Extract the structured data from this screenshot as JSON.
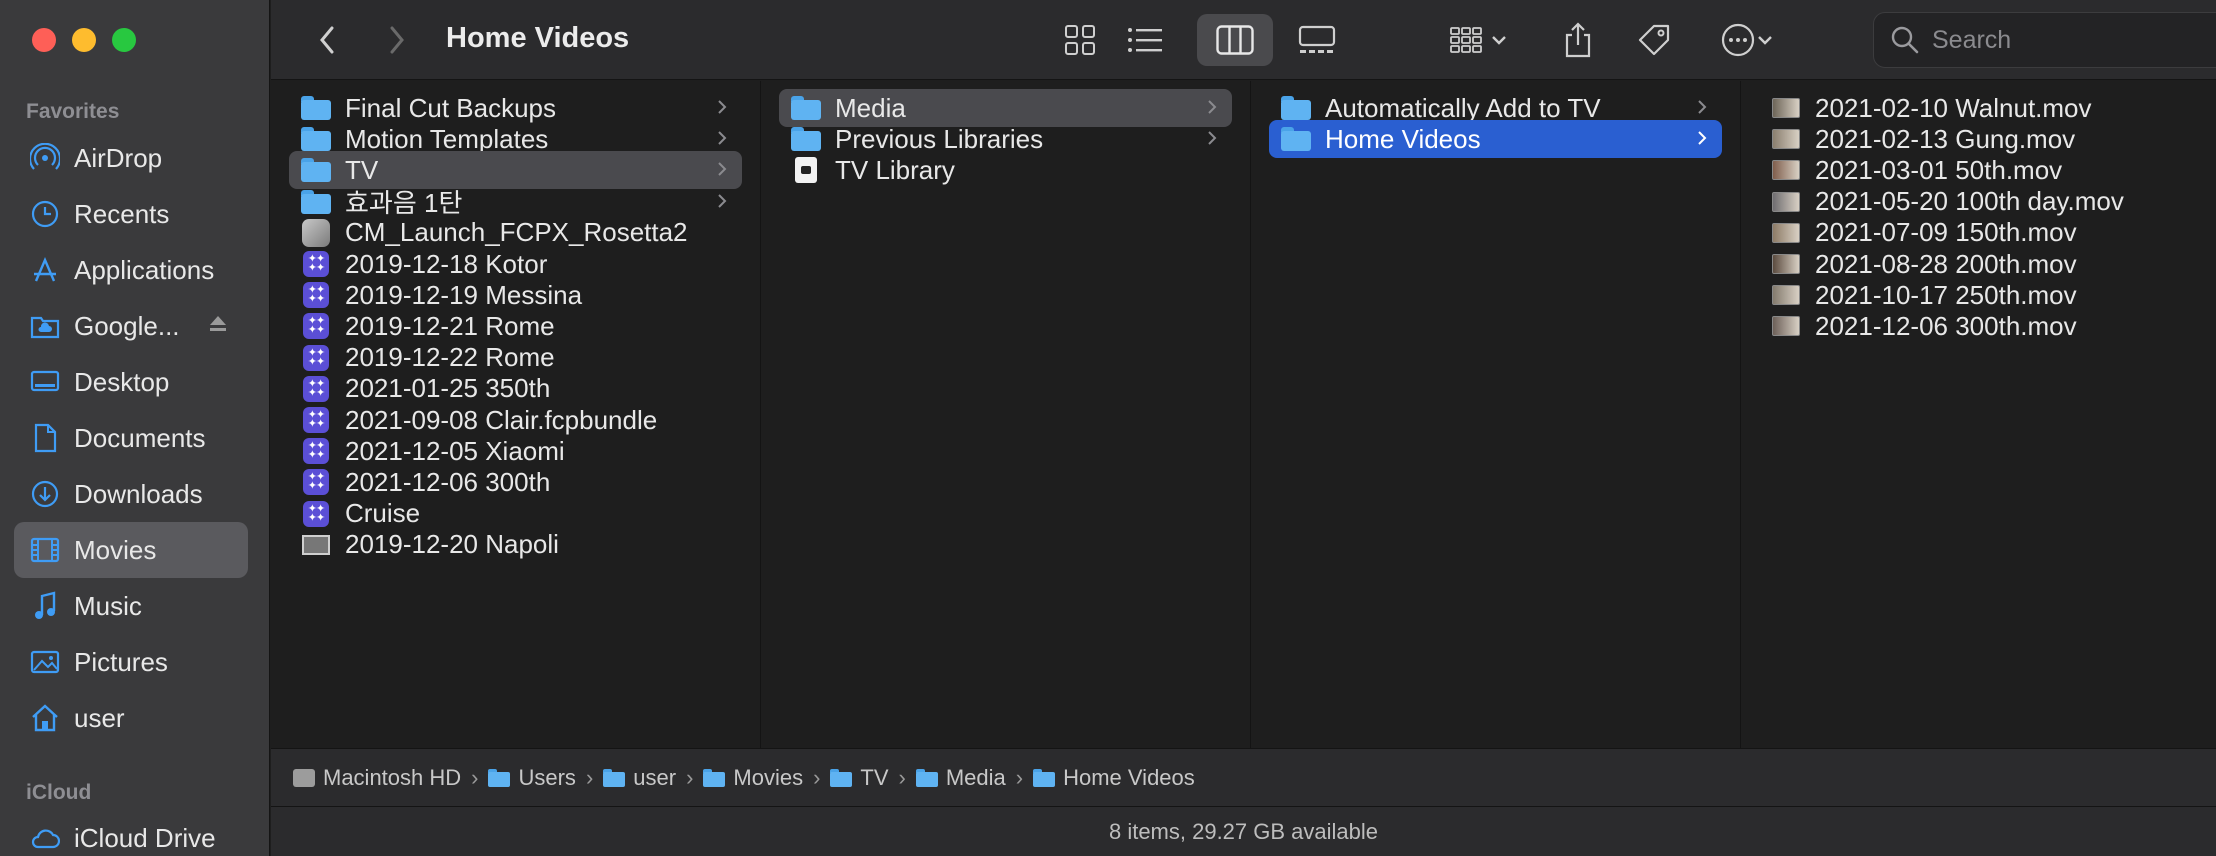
{
  "window": {
    "title": "Home Videos"
  },
  "sidebar": {
    "favorites_heading": "Favorites",
    "items": [
      {
        "label": "AirDrop",
        "icon": "airdrop-icon"
      },
      {
        "label": "Recents",
        "icon": "clock-icon"
      },
      {
        "label": "Applications",
        "icon": "applications-icon"
      },
      {
        "label": "Google...",
        "icon": "cloud-folder-icon"
      },
      {
        "label": "Desktop",
        "icon": "desktop-icon"
      },
      {
        "label": "Documents",
        "icon": "document-icon"
      },
      {
        "label": "Downloads",
        "icon": "download-icon"
      },
      {
        "label": "Movies",
        "icon": "film-icon",
        "selected": true
      },
      {
        "label": "Music",
        "icon": "music-icon"
      },
      {
        "label": "Pictures",
        "icon": "pictures-icon"
      },
      {
        "label": "user",
        "icon": "home-icon"
      }
    ],
    "icloud_heading": "iCloud",
    "icloud_items": [
      {
        "label": "iCloud Drive",
        "icon": "cloud-icon"
      }
    ]
  },
  "toolbar": {
    "search_placeholder": "Search",
    "active_view": "columns"
  },
  "columns": [
    {
      "items": [
        {
          "label": "Final Cut Backups",
          "kind": "folder",
          "chevron": true
        },
        {
          "label": "Motion Templates",
          "kind": "folder",
          "chevron": true
        },
        {
          "label": "TV",
          "kind": "folder",
          "chevron": true,
          "selected": "gray"
        },
        {
          "label": "효과음 1탄",
          "kind": "folder",
          "chevron": true
        },
        {
          "label": "CM_Launch_FCPX_Rosetta2",
          "kind": "app"
        },
        {
          "label": "2019-12-18 Kotor",
          "kind": "fcp-library"
        },
        {
          "label": "2019-12-19 Messina",
          "kind": "fcp-library"
        },
        {
          "label": "2019-12-21 Rome",
          "kind": "fcp-library"
        },
        {
          "label": "2019-12-22 Rome",
          "kind": "fcp-library"
        },
        {
          "label": "2021-01-25 350th",
          "kind": "fcp-library"
        },
        {
          "label": "2021-09-08 Clair.fcpbundle",
          "kind": "fcp-library"
        },
        {
          "label": "2021-12-05 Xiaomi",
          "kind": "fcp-library"
        },
        {
          "label": "2021-12-06 300th",
          "kind": "fcp-library"
        },
        {
          "label": "Cruise",
          "kind": "fcp-library"
        },
        {
          "label": "2019-12-20 Napoli",
          "kind": "image"
        }
      ]
    },
    {
      "items": [
        {
          "label": "Media",
          "kind": "folder",
          "chevron": true,
          "selected": "gray"
        },
        {
          "label": "Previous Libraries",
          "kind": "folder",
          "chevron": true
        },
        {
          "label": "TV Library",
          "kind": "tv-library"
        }
      ]
    },
    {
      "items": [
        {
          "label": "Automatically Add to TV",
          "kind": "folder",
          "chevron": true
        },
        {
          "label": "Home Videos",
          "kind": "folder",
          "chevron": true,
          "selected": "blue"
        }
      ]
    },
    {
      "items": [
        {
          "label": "2021-02-10 Walnut.mov",
          "kind": "video"
        },
        {
          "label": "2021-02-13 Gung.mov",
          "kind": "video"
        },
        {
          "label": "2021-03-01 50th.mov",
          "kind": "video"
        },
        {
          "label": "2021-05-20 100th day.mov",
          "kind": "video"
        },
        {
          "label": "2021-07-09 150th.mov",
          "kind": "video"
        },
        {
          "label": "2021-08-28 200th.mov",
          "kind": "video"
        },
        {
          "label": "2021-10-17 250th.mov",
          "kind": "video"
        },
        {
          "label": "2021-12-06 300th.mov",
          "kind": "video"
        }
      ]
    }
  ],
  "path": [
    {
      "label": "Macintosh HD",
      "kind": "disk"
    },
    {
      "label": "Users",
      "kind": "folder"
    },
    {
      "label": "user",
      "kind": "folder"
    },
    {
      "label": "Movies",
      "kind": "folder"
    },
    {
      "label": "TV",
      "kind": "folder"
    },
    {
      "label": "Media",
      "kind": "folder"
    },
    {
      "label": "Home Videos",
      "kind": "folder"
    }
  ],
  "status": {
    "text": "8 items, 29.27 GB available"
  },
  "colors": {
    "selection_blue": "#2a5fd1",
    "sidebar_icon_blue": "#3f9cf5",
    "folder_blue": "#5fb3f2"
  }
}
